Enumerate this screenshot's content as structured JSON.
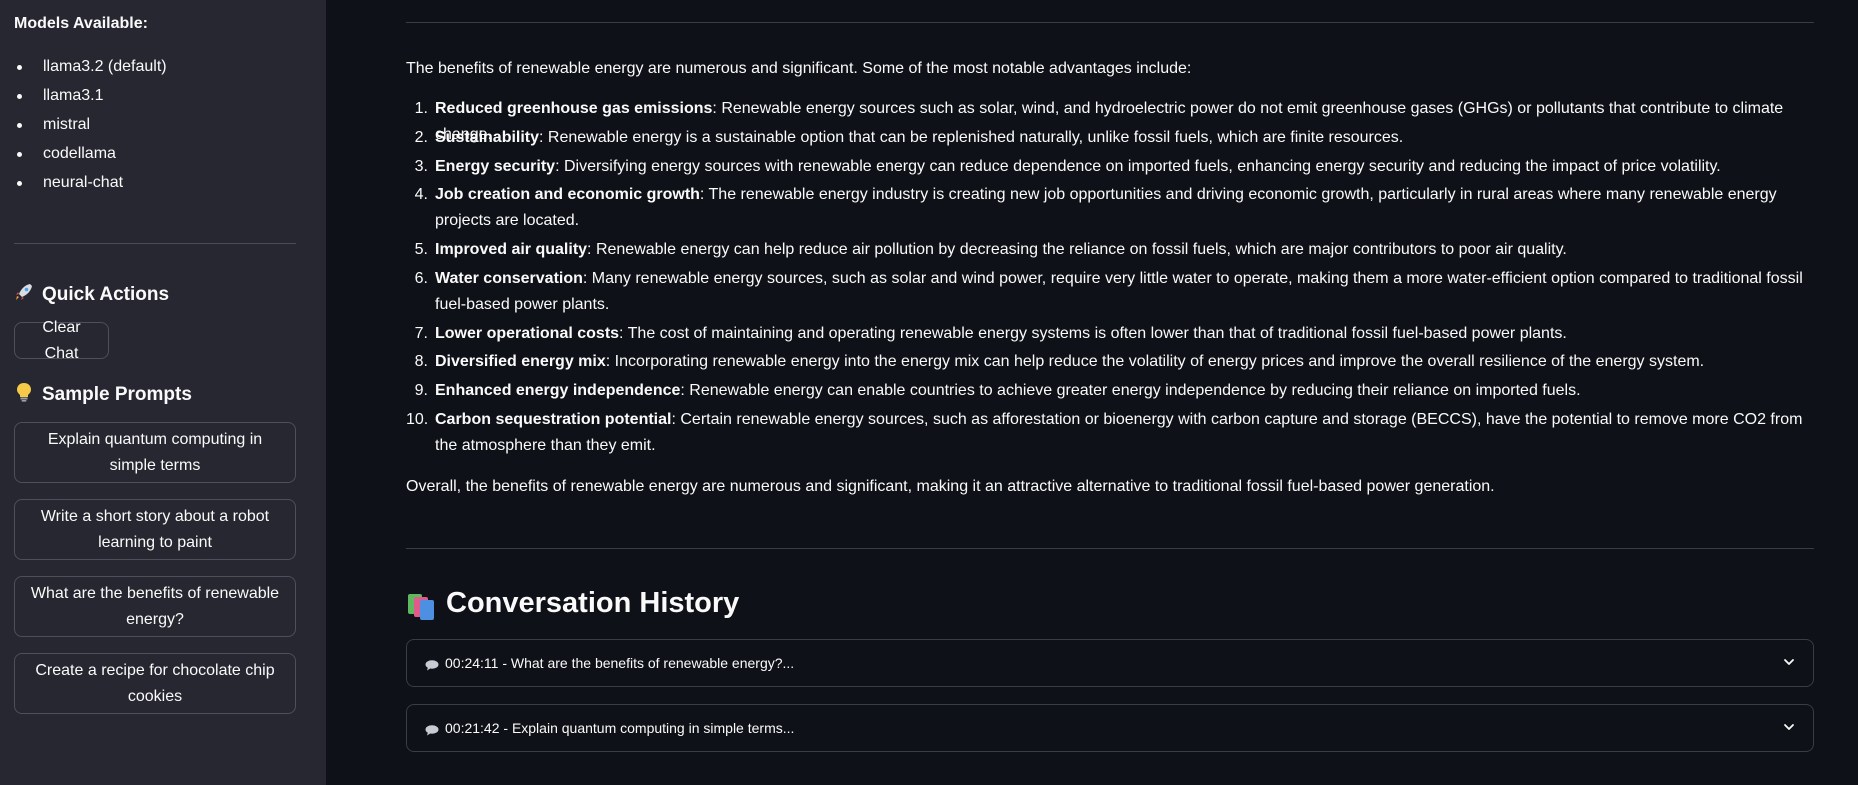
{
  "sidebar": {
    "models_title": "Models Available:",
    "models": [
      "llama3.2 (default)",
      "llama3.1",
      "mistral",
      "codellama",
      "neural-chat"
    ],
    "quick_actions": {
      "icon": "rocket-icon",
      "title": "Quick Actions"
    },
    "clear_chat_label": "Clear Chat",
    "sample_prompts": {
      "icon": "lightbulb-icon",
      "title": "Sample Prompts",
      "items": [
        "Explain quantum computing in simple terms",
        "Write a short story about a robot learning to paint",
        "What are the benefits of renewable energy?",
        "Create a recipe for chocolate chip cookies"
      ]
    }
  },
  "main": {
    "intro": "The benefits of renewable energy are numerous and significant. Some of the most notable advantages include:",
    "benefits": [
      {
        "num": "1.",
        "title": "Reduced greenhouse gas emissions",
        "text": ": Renewable energy sources such as solar, wind, and hydroelectric power do not emit greenhouse gases (GHGs) or pollutants that contribute to climate change."
      },
      {
        "num": "2.",
        "title": "Sustainability",
        "text": ": Renewable energy is a sustainable option that can be replenished naturally, unlike fossil fuels, which are finite resources."
      },
      {
        "num": "3.",
        "title": "Energy security",
        "text": ": Diversifying energy sources with renewable energy can reduce dependence on imported fuels, enhancing energy security and reducing the impact of price volatility."
      },
      {
        "num": "4.",
        "title": "Job creation and economic growth",
        "text": ": The renewable energy industry is creating new job opportunities and driving economic growth, particularly in rural areas where many renewable energy projects are located."
      },
      {
        "num": "5.",
        "title": "Improved air quality",
        "text": ": Renewable energy can help reduce air pollution by decreasing the reliance on fossil fuels, which are major contributors to poor air quality."
      },
      {
        "num": "6.",
        "title": "Water conservation",
        "text": ": Many renewable energy sources, such as solar and wind power, require very little water to operate, making them a more water-efficient option compared to traditional fossil fuel-based power plants."
      },
      {
        "num": "7.",
        "title": "Lower operational costs",
        "text": ": The cost of maintaining and operating renewable energy systems is often lower than that of traditional fossil fuel-based power plants."
      },
      {
        "num": "8.",
        "title": "Diversified energy mix",
        "text": ": Incorporating renewable energy into the energy mix can help reduce the volatility of energy prices and improve the overall resilience of the energy system."
      },
      {
        "num": "9.",
        "title": "Enhanced energy independence",
        "text": ": Renewable energy can enable countries to achieve greater energy independence by reducing their reliance on imported fuels."
      },
      {
        "num": "10.",
        "title": "Carbon sequestration potential",
        "text": ": Certain renewable energy sources, such as afforestation or bioenergy with carbon capture and storage (BECCS), have the potential to remove more CO2 from the atmosphere than they emit."
      }
    ],
    "conclusion": "Overall, the benefits of renewable energy are numerous and significant, making it an attractive alternative to traditional fossil fuel-based power generation.",
    "history": {
      "icon": "books-icon",
      "title": "Conversation History",
      "items": [
        {
          "icon": "speech-bubble-icon",
          "label": "00:24:11 - What are the benefits of renewable energy?..."
        },
        {
          "icon": "speech-bubble-icon",
          "label": "00:21:42 - Explain quantum computing in simple terms..."
        }
      ]
    }
  },
  "colors": {
    "background": "#0e1117",
    "sidebar": "#262730",
    "text": "#fafafa",
    "border": "#3a3c46"
  }
}
